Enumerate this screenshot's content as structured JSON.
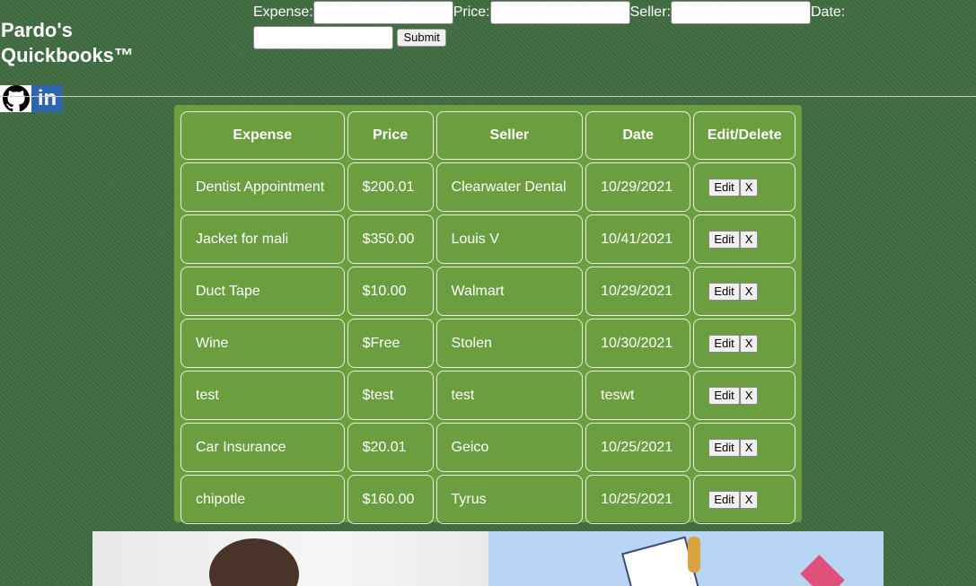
{
  "app": {
    "title": "Pardo's Quickbooks™"
  },
  "form": {
    "expense_label": "Expense:",
    "price_label": "Price:",
    "seller_label": "Seller:",
    "date_label": "Date:",
    "expense_value": "",
    "price_value": "",
    "seller_value": "",
    "date_value": "",
    "submit_label": "Submit"
  },
  "social": {
    "github_icon": "github-icon",
    "linkedin_icon": "linkedin-icon",
    "linkedin_text": "in"
  },
  "table": {
    "headers": [
      "Expense",
      "Price",
      "Seller",
      "Date",
      "Edit/Delete"
    ],
    "rows": [
      [
        "Dentist Appointment",
        "$200.01",
        "Clearwater Dental",
        "10/29/2021"
      ],
      [
        "Jacket for mali",
        "$350.00",
        "Louis V",
        "10/41/2021"
      ],
      [
        "Duct Tape",
        "$10.00",
        "Walmart",
        "10/29/2021"
      ],
      [
        "Wine",
        "$Free",
        "Stolen",
        "10/30/2021"
      ],
      [
        "test",
        "$test",
        "test",
        "teswt"
      ],
      [
        "Car Insurance",
        "$20.01",
        "Geico",
        "10/25/2021"
      ],
      [
        "chipotle",
        "$160.00",
        "Tyrus",
        "10/25/2021"
      ]
    ],
    "edit_label": "Edit",
    "delete_label": "X"
  },
  "colors": {
    "background": "#3e6b3e",
    "table_bg": "#6a9e3f",
    "linkedin": "#2e64b0"
  }
}
